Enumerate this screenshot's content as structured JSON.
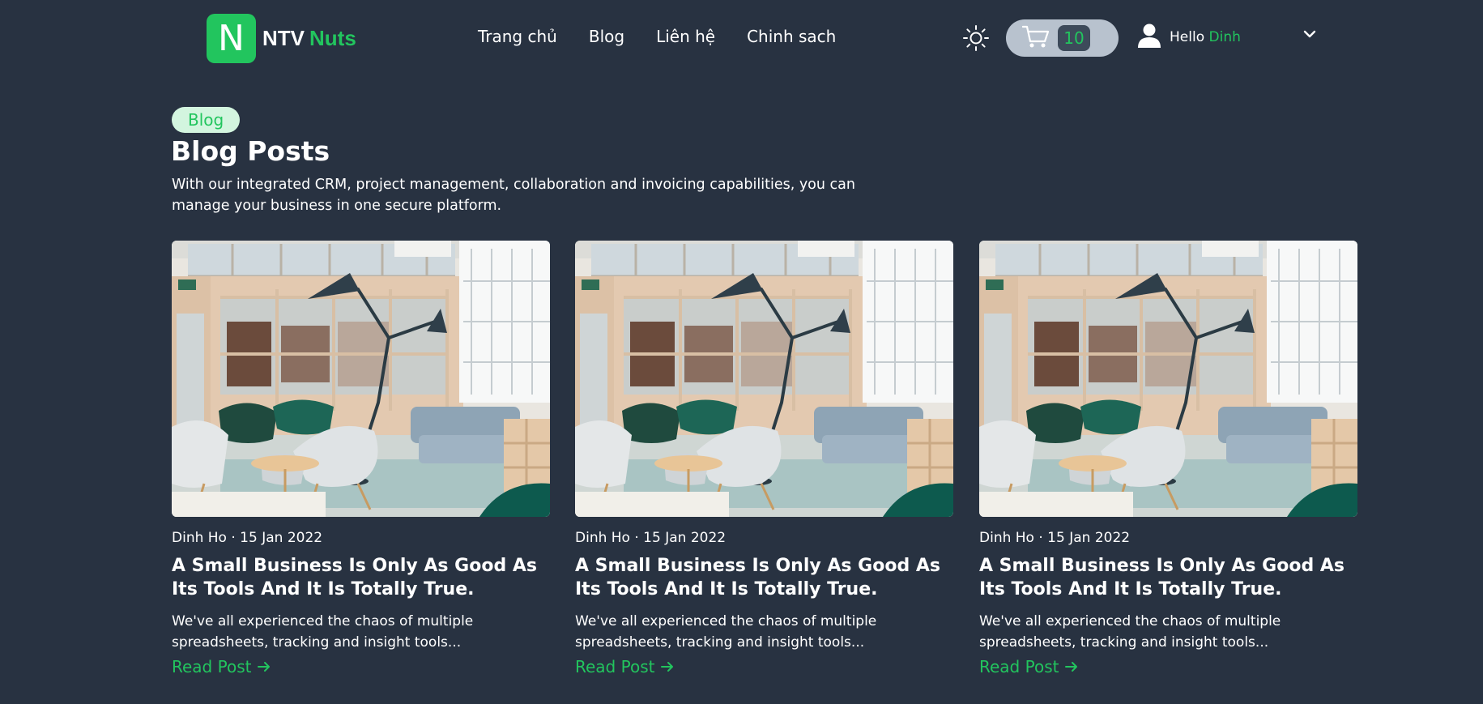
{
  "colors": {
    "background": "#283241",
    "accent": "#22c55e",
    "text": "#ffffff",
    "cart_pill": "#b8c2ce",
    "tag_background": "#d3f5df"
  },
  "header": {
    "logo": {
      "letter": "N",
      "text_part1": "NTV",
      "text_part2": "Nuts"
    },
    "nav": [
      "Trang chủ",
      "Blog",
      "Liên hệ",
      "Chinh sach"
    ],
    "theme_icon": "sun-icon",
    "cart": {
      "icon": "cart-icon",
      "count": "10"
    },
    "user": {
      "icon": "user-icon",
      "greeting": "Hello",
      "name": "Dinh",
      "menu_icon": "chevron-down-icon"
    }
  },
  "intro": {
    "tag": "Blog",
    "title": "Blog Posts",
    "description": "With our integrated CRM, project management, collaboration and invoicing capabilities, you can manage your business in one secure platform."
  },
  "posts": [
    {
      "image": "office-interior-photo",
      "author": "Dinh Ho",
      "date": "15 Jan 2022",
      "separator": "·",
      "title": "A Small Business Is Only As Good As Its Tools And It Is Totally True.",
      "excerpt": "We've all experienced the chaos of multiple spreadsheets, tracking and insight tools...",
      "cta": "Read Post"
    },
    {
      "image": "office-interior-photo",
      "author": "Dinh Ho",
      "date": "15 Jan 2022",
      "separator": "·",
      "title": "A Small Business Is Only As Good As Its Tools And It Is Totally True.",
      "excerpt": "We've all experienced the chaos of multiple spreadsheets, tracking and insight tools...",
      "cta": "Read Post"
    },
    {
      "image": "office-interior-photo",
      "author": "Dinh Ho",
      "date": "15 Jan 2022",
      "separator": "·",
      "title": "A Small Business Is Only As Good As Its Tools And It Is Totally True.",
      "excerpt": "We've all experienced the chaos of multiple spreadsheets, tracking and insight tools...",
      "cta": "Read Post"
    }
  ]
}
